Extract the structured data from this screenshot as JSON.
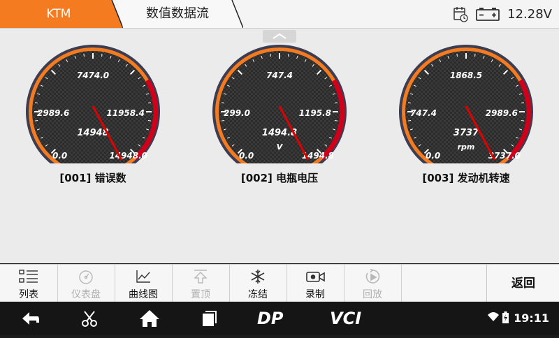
{
  "header": {
    "brand_tab": "KTM",
    "title_tab": "数值数据流",
    "voltage": "12.28V",
    "calendar_icon": "calendar-clock-icon",
    "battery_icon": "battery-icon"
  },
  "colors": {
    "accent": "#f47b20",
    "needle": "#e00000",
    "redline": "#d0001a"
  },
  "gauges": [
    {
      "label": "[001] 错误数",
      "ticks": {
        "top": "7474.0",
        "left": "2989.6",
        "right": "11958.4",
        "min": "0.0",
        "max": "14948.0"
      },
      "value_text": "14948",
      "unit": "",
      "value": 14948,
      "min_value": 0,
      "max_value": 14948
    },
    {
      "label": "[002] 电瓶电压",
      "ticks": {
        "top": "747.4",
        "left": "299.0",
        "right": "1195.8",
        "min": "0.0",
        "max": "1494.8"
      },
      "value_text": "1494.8",
      "unit": "V",
      "value": 1494.8,
      "min_value": 0,
      "max_value": 1494.8
    },
    {
      "label": "[003] 发动机转速",
      "ticks": {
        "top": "1868.5",
        "left": "747.4",
        "right": "2989.6",
        "min": "0.0",
        "max": "3737.0"
      },
      "value_text": "3737",
      "unit": "rpm",
      "value": 3737,
      "min_value": 0,
      "max_value": 3737
    }
  ],
  "toolbar": {
    "items": [
      {
        "label": "列表",
        "icon": "list-icon",
        "enabled": true
      },
      {
        "label": "仪表盘",
        "icon": "gauge-icon",
        "enabled": false
      },
      {
        "label": "曲线图",
        "icon": "line-chart-icon",
        "enabled": true
      },
      {
        "label": "置顶",
        "icon": "pin-top-icon",
        "enabled": false
      },
      {
        "label": "冻结",
        "icon": "snowflake-icon",
        "enabled": true
      },
      {
        "label": "录制",
        "icon": "video-record-icon",
        "enabled": true
      },
      {
        "label": "回放",
        "icon": "playback-icon",
        "enabled": false
      }
    ],
    "back_label": "返回"
  },
  "navbar": {
    "time": "19:11",
    "dp_label": "DP",
    "vci_label": "VCI"
  }
}
